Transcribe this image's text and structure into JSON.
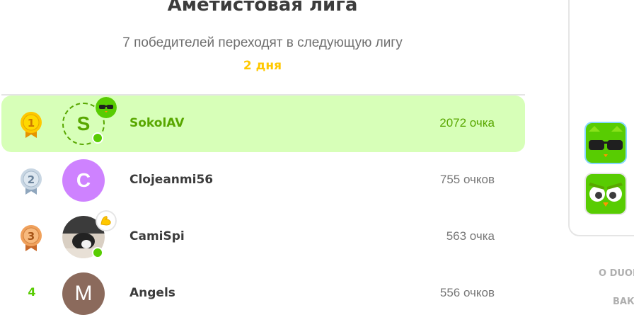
{
  "league": {
    "title": "Аметистовая лига",
    "subtitle": "7 победителей переходят в следующую лигу",
    "time_left": "2 дня"
  },
  "leaderboard": [
    {
      "rank": "1",
      "initial": "S",
      "name": "SokolAV",
      "xp": "2072 очка",
      "highlight": true,
      "medal": "gold-medal-icon"
    },
    {
      "rank": "2",
      "initial": "C",
      "name": "Clojeanmi56",
      "xp": "755 очков",
      "medal": "silver-medal-icon"
    },
    {
      "rank": "3",
      "initial": "",
      "name": "CamiSpi",
      "xp": "563 очка",
      "medal": "bronze-medal-icon"
    },
    {
      "rank": "4",
      "initial": "M",
      "name": "Angels",
      "xp": "556 очков"
    }
  ],
  "sidebar": {
    "footer_links": [
      "О DUOL",
      "ВАК"
    ]
  },
  "colors": {
    "highlight": "#d7ffb8",
    "green": "#58cc02",
    "gold": "#ffc800",
    "purple_avatar": "#ce82ff",
    "brown_avatar": "#8b6a5c"
  }
}
